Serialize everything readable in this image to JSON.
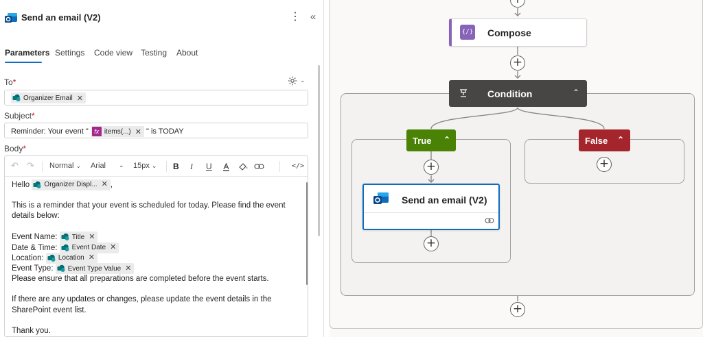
{
  "panel": {
    "title": "Send an email (V2)",
    "more_icon": "more-vertical-icon",
    "collapse_icon": "double-chevron-left-icon",
    "tabs": [
      {
        "label": "Parameters",
        "active": true
      },
      {
        "label": "Settings",
        "active": false
      },
      {
        "label": "Code view",
        "active": false
      },
      {
        "label": "Testing",
        "active": false
      },
      {
        "label": "About",
        "active": false
      }
    ],
    "to": {
      "label": "To",
      "required": "*",
      "tokens": [
        {
          "label": "Organizer Email",
          "source": "sharepoint"
        }
      ]
    },
    "subject": {
      "label": "Subject",
      "required": "*",
      "prefix": "Reminder: Your event \"",
      "expression_token": "items(...)",
      "suffix": "\" is TODAY"
    },
    "body": {
      "label": "Body",
      "required": "*",
      "toolbar": {
        "undo_icon": "undo-icon",
        "redo_icon": "redo-icon",
        "paragraph_style": "Normal",
        "font": "Arial",
        "font_size": "15px",
        "bold": "B",
        "italic": "I",
        "underline": "U",
        "code_toggle": "</>"
      },
      "hello_prefix": "Hello",
      "hello_token": "Organizer Displ...",
      "hello_suffix": ",",
      "intro_line1": "This is a reminder that your event is scheduled for today. Please find the event",
      "intro_line2": "details below:",
      "fields": [
        {
          "label": "Event Name:",
          "token": "Title"
        },
        {
          "label": "Date & Time:",
          "token": "Event Date"
        },
        {
          "label": "Location:",
          "token": "Location"
        },
        {
          "label": "Event Type:",
          "token": "Event Type Value"
        }
      ],
      "prep_line": "Please ensure that all preparations are completed before the event starts.",
      "update_line1": "If there are any updates or changes, please update the event details in the",
      "update_line2": "SharePoint event list.",
      "closing": "Thank you."
    }
  },
  "canvas": {
    "compose": {
      "title": "Compose",
      "icon": "curly-braces-icon",
      "accent": "#8764b8"
    },
    "condition": {
      "title": "Condition",
      "icon": "condition-icon",
      "color": "#484644"
    },
    "true_branch": {
      "label": "True",
      "color": "#498205"
    },
    "false_branch": {
      "label": "False",
      "color": "#a4262c"
    },
    "email_action": {
      "title": "Send an email (V2)",
      "icon": "outlook-icon",
      "footer_icon": "link-icon"
    }
  }
}
